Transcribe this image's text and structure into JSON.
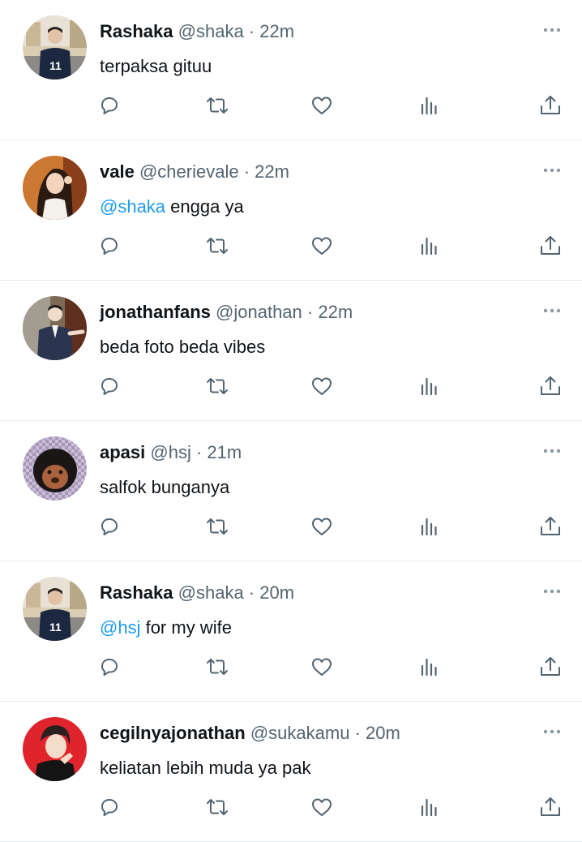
{
  "tweets": [
    {
      "name": "Rashaka",
      "handle": "@shaka",
      "sep": " · ",
      "time": "22m",
      "mention": "",
      "text": "terpaksa gituu"
    },
    {
      "name": "vale",
      "handle": "@cherievale",
      "sep": " · ",
      "time": "22m",
      "mention": "@shaka",
      "text": " engga ya"
    },
    {
      "name": "jonathanfans",
      "handle": "@jonathan",
      "sep": " · ",
      "time": "22m",
      "mention": "",
      "text": "beda foto beda vibes"
    },
    {
      "name": "apasi",
      "handle": "@hsj",
      "sep": " · ",
      "time": "21m",
      "mention": "",
      "text": "salfok bunganya"
    },
    {
      "name": "Rashaka",
      "handle": "@shaka",
      "sep": " · ",
      "time": "20m",
      "mention": "@hsj",
      "text": " for my wife"
    },
    {
      "name": "cegilnyajonathan",
      "handle": "@sukakamu",
      "sep": " · ",
      "time": "20m",
      "mention": "",
      "text": "keliatan lebih muda ya pak"
    }
  ],
  "icons": {
    "reply": "reply-icon",
    "retweet": "retweet-icon",
    "like": "like-icon",
    "views": "views-icon",
    "share": "share-icon",
    "more": "more-icon"
  },
  "colors": {
    "text": "#0f1419",
    "muted": "#536471",
    "mention": "#1d9bf0",
    "divider": "#e6e9ec"
  }
}
